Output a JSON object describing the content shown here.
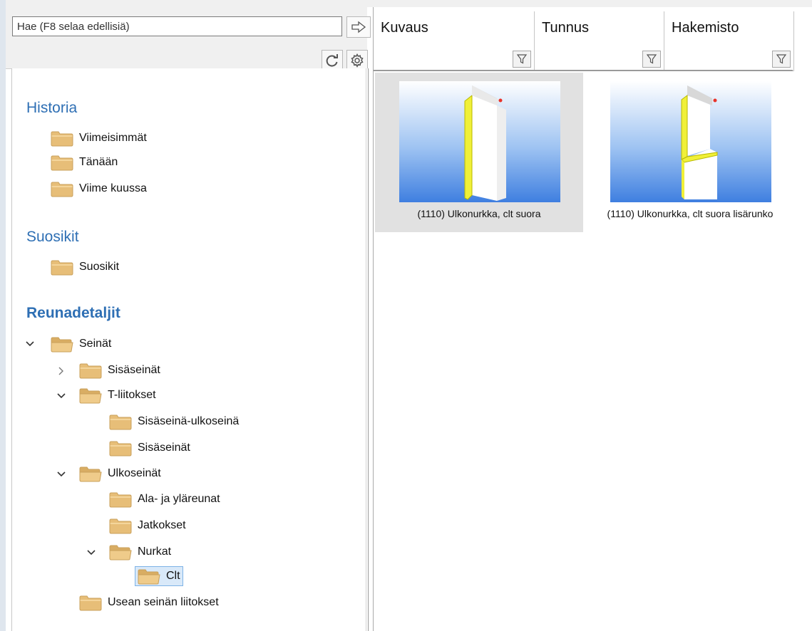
{
  "search": {
    "placeholder": "Hae (F8 selaa edellisiä)"
  },
  "toolbar": {
    "go_icon": "arrow-right-icon",
    "refresh_icon": "refresh-icon",
    "settings_icon": "gear-icon"
  },
  "tree": {
    "history_header": "Historia",
    "history_items": [
      "Viimeisimmät",
      "Tänään",
      "Viime kuussa"
    ],
    "favorites_header": "Suosikit",
    "favorites_items": [
      "Suosikit"
    ],
    "details_header": "Reunadetaljit",
    "nodes": {
      "seinat": "Seinät",
      "sisaseinat": "Sisäseinät",
      "t_liitokset": "T-liitokset",
      "sisaseina_ulkoseina": "Sisäseinä-ulkoseinä",
      "t_sisaseinat": "Sisäseinät",
      "ulkoseinat": "Ulkoseinät",
      "ala_ja_ylareunat": "Ala- ja yläreunat",
      "jatkokset": "Jatkokset",
      "nurkat": "Nurkat",
      "clt": "Clt",
      "usean_seinan_liitokset": "Usean seinän liitokset"
    },
    "selected": "Clt"
  },
  "columns": [
    "Kuvaus",
    "Tunnus",
    "Hakemisto"
  ],
  "items": [
    {
      "label": "(1110) Ulkonurkka, clt suora",
      "selected": true
    },
    {
      "label": "(1110) Ulkonurkka, clt suora lisärunko",
      "selected": false
    }
  ],
  "colors": {
    "section": "#2e6fb4",
    "folder": "#e9c07a",
    "selection": "#d9e9f9"
  }
}
